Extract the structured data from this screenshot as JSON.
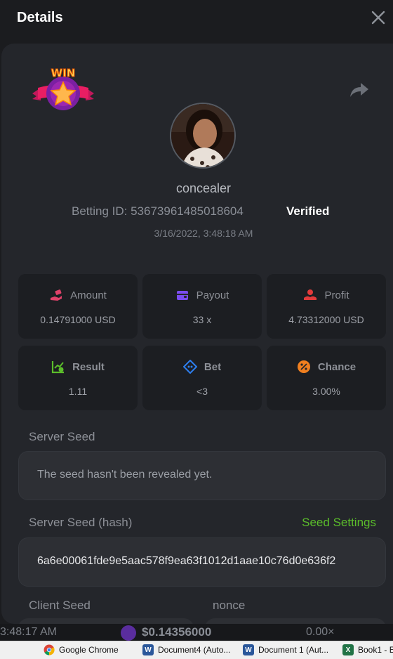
{
  "header": {
    "title": "Details"
  },
  "user": {
    "username": "concealer",
    "betting_id": "Betting ID: 53673961485018604",
    "verified": "Verified",
    "timestamp": "3/16/2022, 3:48:18 AM"
  },
  "badge": {
    "text": "WIN"
  },
  "stats": [
    {
      "label": "Amount",
      "value": "0.14791000 USD",
      "icon": "money-hand-icon",
      "color": "#e0426a"
    },
    {
      "label": "Payout",
      "value": "33 x",
      "icon": "wallet-icon",
      "color": "#7b4cf0"
    },
    {
      "label": "Profit",
      "value": "4.73312000 USD",
      "icon": "profit-hand-icon",
      "color": "#e23b3b"
    },
    {
      "label": "Result",
      "value": "1.11",
      "icon": "chart-check-icon",
      "color": "#5bbd2b"
    },
    {
      "label": "Bet",
      "value": "<3",
      "icon": "ticket-icon",
      "color": "#2d7ff0"
    },
    {
      "label": "Chance",
      "value": "3.00%",
      "icon": "percent-icon",
      "color": "#f07f1f"
    }
  ],
  "server_seed": {
    "label": "Server Seed",
    "value": "The seed hasn't been revealed yet."
  },
  "server_seed_hash": {
    "label": "Server Seed (hash)",
    "link": "Seed Settings",
    "value": "6a6e00061fde9e5aac578f9ea63f1012d1aae10c76d0e636f2"
  },
  "client_seed": {
    "label": "Client Seed"
  },
  "nonce": {
    "label": "nonce"
  },
  "background_row": {
    "time": "3:48:17 AM",
    "amount": "$0.14356000",
    "percent": "0.00×"
  },
  "taskbar": {
    "items": [
      {
        "label": "Google Chrome",
        "icon": "chrome-icon"
      },
      {
        "label": "Document4 (Auto...",
        "icon": "word-icon"
      },
      {
        "label": "Document 1 (Aut...",
        "icon": "word-icon"
      },
      {
        "label": "Book1 - E",
        "icon": "excel-icon"
      }
    ]
  }
}
